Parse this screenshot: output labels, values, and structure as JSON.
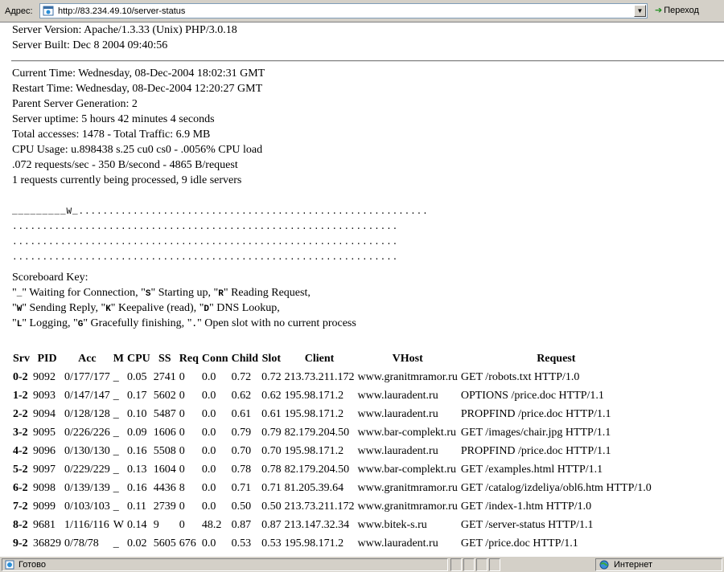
{
  "addressbar": {
    "label": "Адрес:",
    "url": "http://83.234.49.10/server-status",
    "go_label": "Переход"
  },
  "server": {
    "version": "Server Version: Apache/1.3.33 (Unix) PHP/3.0.18",
    "built": "Server Built: Dec 8 2004 09:40:56"
  },
  "stats": [
    "Current Time: Wednesday, 08-Dec-2004 18:02:31 GMT",
    "Restart Time: Wednesday, 08-Dec-2004 12:20:27 GMT",
    "Parent Server Generation: 2",
    "Server uptime: 5 hours 42 minutes 4 seconds",
    "Total accesses: 1478 - Total Traffic: 6.9 MB",
    "CPU Usage: u.898438 s.25 cu0 cs0 - .0056% CPU load",
    ".072 requests/sec - 350 B/second - 4865 B/request",
    "1 requests currently being processed, 9 idle servers"
  ],
  "scoreboard": [
    "_________W_..........................................................",
    "................................................................",
    "................................................................",
    "................................................................"
  ],
  "key": {
    "title": "Scoreboard Key:",
    "line1": [
      {
        "k": "_",
        "t": " Waiting for Connection, "
      },
      {
        "k": "S",
        "t": " Starting up, "
      },
      {
        "k": "R",
        "t": " Reading Request,"
      }
    ],
    "line2": [
      {
        "k": "W",
        "t": " Sending Reply, "
      },
      {
        "k": "K",
        "t": " Keepalive (read), "
      },
      {
        "k": "D",
        "t": " DNS Lookup,"
      }
    ],
    "line3": [
      {
        "k": "L",
        "t": " Logging, "
      },
      {
        "k": "G",
        "t": " Gracefully finishing, "
      },
      {
        "k": ".",
        "t": " Open slot with no current process"
      }
    ]
  },
  "table": {
    "headers": [
      "Srv",
      "PID",
      "Acc",
      "M",
      "CPU",
      "SS",
      "Req",
      "Conn",
      "Child",
      "Slot",
      "Client",
      "VHost",
      "Request"
    ],
    "rows": [
      [
        "0-2",
        "9092",
        "0/177/177",
        "_",
        "0.05",
        "2741",
        "0",
        "0.0",
        "0.72",
        "0.72",
        "213.73.211.172",
        "www.granitmramor.ru",
        "GET /robots.txt HTTP/1.0"
      ],
      [
        "1-2",
        "9093",
        "0/147/147",
        "_",
        "0.17",
        "5602",
        "0",
        "0.0",
        "0.62",
        "0.62",
        "195.98.171.2",
        "www.lauradent.ru",
        "OPTIONS /price.doc HTTP/1.1"
      ],
      [
        "2-2",
        "9094",
        "0/128/128",
        "_",
        "0.10",
        "5487",
        "0",
        "0.0",
        "0.61",
        "0.61",
        "195.98.171.2",
        "www.lauradent.ru",
        "PROPFIND /price.doc HTTP/1.1"
      ],
      [
        "3-2",
        "9095",
        "0/226/226",
        "_",
        "0.09",
        "1606",
        "0",
        "0.0",
        "0.79",
        "0.79",
        "82.179.204.50",
        "www.bar-complekt.ru",
        "GET /images/chair.jpg HTTP/1.1"
      ],
      [
        "4-2",
        "9096",
        "0/130/130",
        "_",
        "0.16",
        "5508",
        "0",
        "0.0",
        "0.70",
        "0.70",
        "195.98.171.2",
        "www.lauradent.ru",
        "PROPFIND /price.doc HTTP/1.1"
      ],
      [
        "5-2",
        "9097",
        "0/229/229",
        "_",
        "0.13",
        "1604",
        "0",
        "0.0",
        "0.78",
        "0.78",
        "82.179.204.50",
        "www.bar-complekt.ru",
        "GET /examples.html HTTP/1.1"
      ],
      [
        "6-2",
        "9098",
        "0/139/139",
        "_",
        "0.16",
        "4436",
        "8",
        "0.0",
        "0.71",
        "0.71",
        "81.205.39.64",
        "www.granitmramor.ru",
        "GET /catalog/izdeliya/obl6.htm HTTP/1.0"
      ],
      [
        "7-2",
        "9099",
        "0/103/103",
        "_",
        "0.11",
        "2739",
        "0",
        "0.0",
        "0.50",
        "0.50",
        "213.73.211.172",
        "www.granitmramor.ru",
        "GET /index-1.htm HTTP/1.0"
      ],
      [
        "8-2",
        "9681",
        "1/116/116",
        "W",
        "0.14",
        "9",
        "0",
        "48.2",
        "0.87",
        "0.87",
        "213.147.32.34",
        "www.bitek-s.ru",
        "GET /server-status HTTP/1.1"
      ],
      [
        "9-2",
        "36829",
        "0/78/78",
        "_",
        "0.02",
        "5605",
        "676",
        "0.0",
        "0.53",
        "0.53",
        "195.98.171.2",
        "www.lauradent.ru",
        "GET /price.doc HTTP/1.1"
      ]
    ]
  },
  "statusbar": {
    "text": "Готово",
    "zone": "Интернет"
  }
}
